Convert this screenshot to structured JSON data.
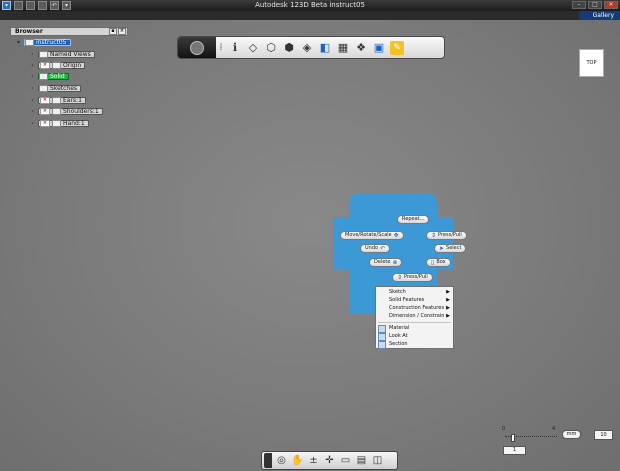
{
  "app": {
    "title": "Autodesk 123D Beta    instruct05",
    "gallery_label": "Gallery"
  },
  "browser": {
    "title": "Browser",
    "items": [
      {
        "label": "instruct05",
        "state": "selected"
      },
      {
        "label": "Named Views"
      },
      {
        "label": "Origin"
      },
      {
        "label": "Solid",
        "state": "highlight"
      },
      {
        "label": "Sketches"
      },
      {
        "label": "Ears:1"
      },
      {
        "label": "Shoulders:1"
      },
      {
        "label": "Hand:1"
      }
    ]
  },
  "viewcube": {
    "face": "TOP"
  },
  "marking_menu": {
    "repeat": "Repeat...",
    "press_pull_top": "Press/Pull",
    "move": "Move/Rotate/Scale",
    "select": "Select",
    "undo": "Undo",
    "delete": "Delete",
    "box": "Box",
    "press_pull_bottom": "Press/Pull"
  },
  "context_menu": {
    "items": [
      {
        "label": "Sketch",
        "submenu": true
      },
      {
        "label": "Solid Features",
        "submenu": true
      },
      {
        "label": "Construction Features",
        "submenu": true
      },
      {
        "label": "Dimension / Constrain",
        "submenu": true
      },
      {
        "label": "Material",
        "submenu": false
      },
      {
        "label": "Look At",
        "submenu": false
      },
      {
        "label": "Section",
        "submenu": false
      }
    ]
  },
  "grid": {
    "range_min": "0",
    "range_max": "4",
    "units": "mm",
    "size": "10",
    "subdivisions": "1"
  },
  "colors": {
    "accent": "#1e5fb8",
    "marking": "#3d99d6",
    "solid_chip": "#18b43a"
  }
}
